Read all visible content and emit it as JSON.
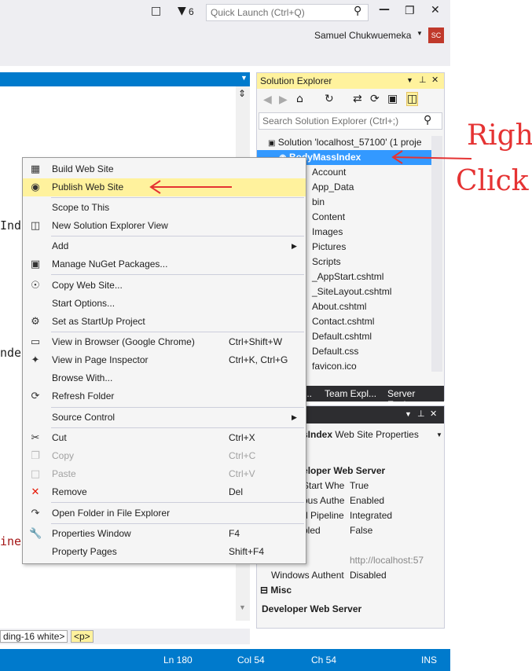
{
  "titlebar": {
    "notification_count": "6",
    "quick_launch_placeholder": "Quick Launch (Ctrl+Q)",
    "user_name": "Samuel Chukwuemeka",
    "avatar_initials": "SC"
  },
  "editor": {
    "fragments": [
      "Ind",
      "nde",
      "ine"
    ]
  },
  "solution_explorer": {
    "title": "Solution Explorer",
    "search_placeholder": "Search Solution Explorer (Ctrl+;)",
    "tree": [
      "Solution 'localhost_57100' (1 proje",
      "BodyMassIndex",
      "Account",
      "App_Data",
      "bin",
      "Content",
      "Images",
      "Pictures",
      "Scripts",
      "_AppStart.cshtml",
      "_SiteLayout.cshtml",
      "About.cshtml",
      "Contact.cshtml",
      "Default.cshtml",
      "Default.css",
      "favicon.ico"
    ],
    "tabs": [
      "...",
      "Team Expl...",
      "Server Expl..."
    ]
  },
  "properties": {
    "object_name": "sIndex",
    "object_type": "Web Site Properties",
    "category_dev_server": "Developer Web Server",
    "rows": [
      {
        "name": "Start Whe",
        "value": "True"
      },
      {
        "name": "ous Authe",
        "value": "Enabled"
      },
      {
        "name": "d Pipeline",
        "value": "Integrated"
      },
      {
        "name": "bled",
        "value": "False"
      },
      {
        "name": "",
        "value": ""
      },
      {
        "name": "",
        "value": "http://localhost:57"
      },
      {
        "name": "Windows Authent",
        "value": "Disabled"
      }
    ],
    "category_misc": "Misc",
    "description_title": "Developer Web Server"
  },
  "context_menu": {
    "items": [
      {
        "icon": "build-icon",
        "label": "Build Web Site",
        "shortcut": ""
      },
      {
        "icon": "publish-icon",
        "label": "Publish Web Site",
        "shortcut": ""
      },
      {
        "icon": "",
        "label": "Scope to This",
        "shortcut": ""
      },
      {
        "icon": "new-view-icon",
        "label": "New Solution Explorer View",
        "shortcut": ""
      },
      {
        "icon": "",
        "label": "Add",
        "shortcut": ""
      },
      {
        "icon": "nuget-icon",
        "label": "Manage NuGet Packages...",
        "shortcut": ""
      },
      {
        "icon": "copy-site-icon",
        "label": "Copy Web Site...",
        "shortcut": ""
      },
      {
        "icon": "",
        "label": "Start Options...",
        "shortcut": ""
      },
      {
        "icon": "gear-icon",
        "label": "Set as StartUp Project",
        "shortcut": ""
      },
      {
        "icon": "browser-icon",
        "label": "View in Browser (Google Chrome)",
        "shortcut": "Ctrl+Shift+W"
      },
      {
        "icon": "inspector-icon",
        "label": "View in Page Inspector",
        "shortcut": "Ctrl+K, Ctrl+G"
      },
      {
        "icon": "",
        "label": "Browse With...",
        "shortcut": ""
      },
      {
        "icon": "refresh-icon",
        "label": "Refresh Folder",
        "shortcut": ""
      },
      {
        "icon": "",
        "label": "Source Control",
        "shortcut": ""
      },
      {
        "icon": "cut-icon",
        "label": "Cut",
        "shortcut": "Ctrl+X"
      },
      {
        "icon": "copy-icon",
        "label": "Copy",
        "shortcut": "Ctrl+C"
      },
      {
        "icon": "paste-icon",
        "label": "Paste",
        "shortcut": "Ctrl+V"
      },
      {
        "icon": "remove-icon",
        "label": "Remove",
        "shortcut": "Del"
      },
      {
        "icon": "open-folder-icon",
        "label": "Open Folder in File Explorer",
        "shortcut": ""
      },
      {
        "icon": "wrench-icon",
        "label": "Properties Window",
        "shortcut": "F4"
      },
      {
        "icon": "",
        "label": "Property Pages",
        "shortcut": "Shift+F4"
      }
    ]
  },
  "breadcrumbs": [
    "ding-16 white>",
    "<p>"
  ],
  "statusbar": {
    "line": "Ln 180",
    "col": "Col 54",
    "ch": "Ch 54",
    "mode": "INS"
  },
  "annotation": {
    "line1": "Right",
    "line2": "Click"
  },
  "colors": {
    "accent": "#007acc",
    "highlight": "#fff29d",
    "selection": "#3399ff",
    "annotation": "#e53333"
  }
}
